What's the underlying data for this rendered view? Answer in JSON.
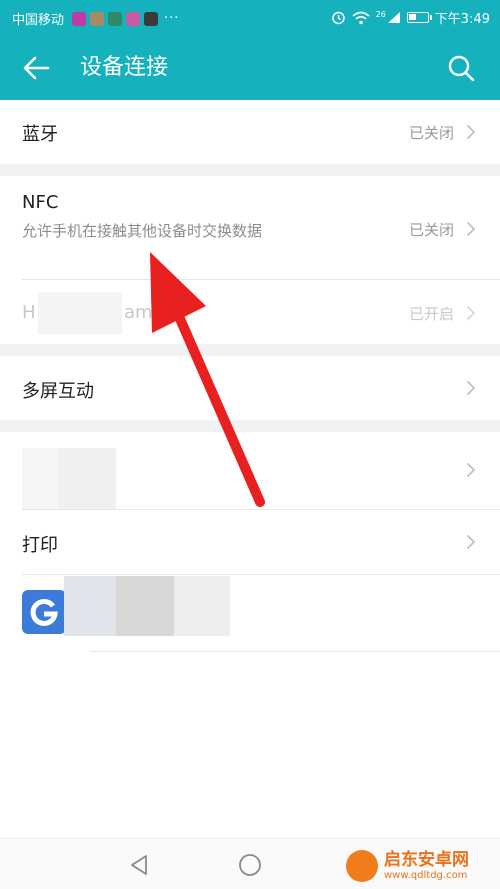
{
  "status_bar": {
    "carrier": "中国移动",
    "overflow": "···",
    "signal_label": "26",
    "time": "下午3:49",
    "app_icons": [
      "#c03aa4",
      "#a98b63",
      "#2d8b67",
      "#c85aa0",
      "#3a3a3a"
    ]
  },
  "app_bar": {
    "title": "设备连接",
    "back_icon": "arrow-left-icon",
    "search_icon": "search-icon",
    "color": "#15b1bd"
  },
  "rows": {
    "bluetooth": {
      "label": "蓝牙",
      "value": "已关闭"
    },
    "nfc": {
      "label": "NFC",
      "description": "允许手机在接触其他设备时交换数据",
      "value": "已关闭"
    },
    "hidden_device": {
      "label_prefix": "H",
      "label_suffix": "am",
      "value": "已开启"
    },
    "multiscreen": {
      "label": "多屏互动"
    },
    "print": {
      "label": "打印"
    }
  },
  "google": {
    "letter": "G",
    "color": "#3d7bd9"
  },
  "annotation": {
    "color": "#e8201f"
  },
  "nav_bar": {
    "back_icon": "triangle-back-icon",
    "home_icon": "circle-home-icon",
    "recents_icon": "square-recents-icon"
  },
  "watermark": {
    "name": "启东安卓网",
    "url": "www.qdltdg.com"
  }
}
